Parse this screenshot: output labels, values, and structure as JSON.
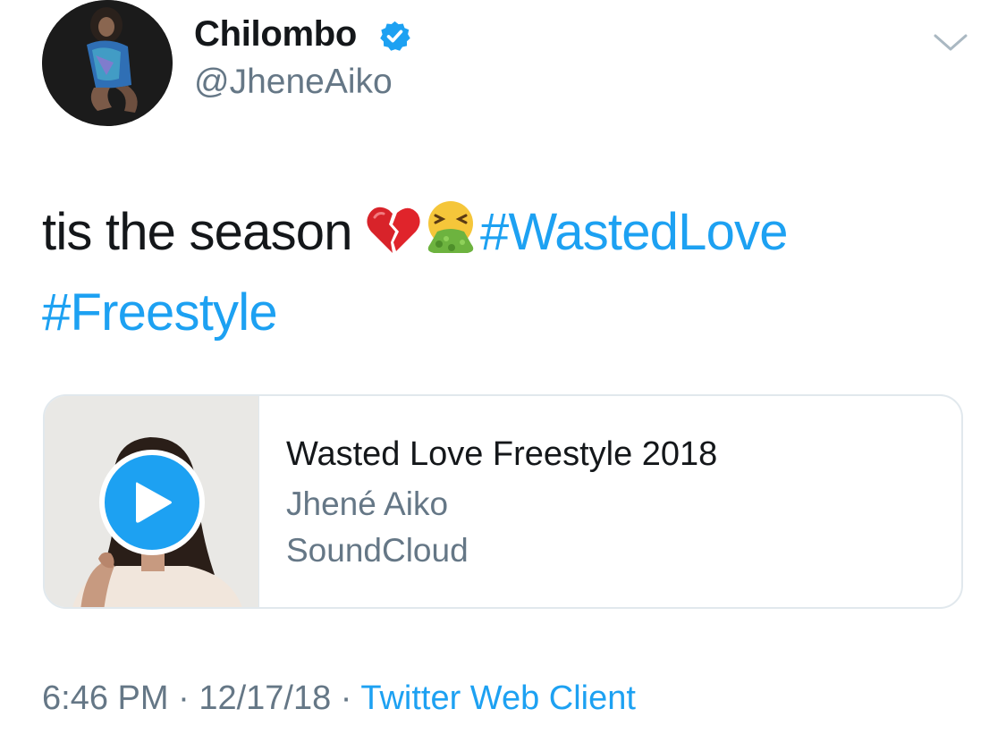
{
  "user": {
    "display_name": "Chilombo",
    "handle": "@JheneAiko",
    "verified": true
  },
  "tweet": {
    "text_plain": "tis the season ",
    "emojis": [
      "broken-heart-emoji",
      "vomiting-face-emoji"
    ],
    "hashtags": [
      "#WastedLove",
      "#Freestyle"
    ]
  },
  "card": {
    "title": "Wasted Love Freestyle 2018",
    "artist": "Jhené Aiko",
    "source": "SoundCloud"
  },
  "meta": {
    "time": "6:46 PM",
    "separator1": " · ",
    "date": "12/17/18",
    "separator2": " · ",
    "client": "Twitter Web Client"
  },
  "colors": {
    "accent": "#1da1f2",
    "text": "#14171a",
    "secondary": "#657786",
    "border": "#e1e8ed"
  },
  "icons": {
    "verified": "verified-badge-icon",
    "menu": "chevron-down-icon",
    "play": "play-icon"
  }
}
